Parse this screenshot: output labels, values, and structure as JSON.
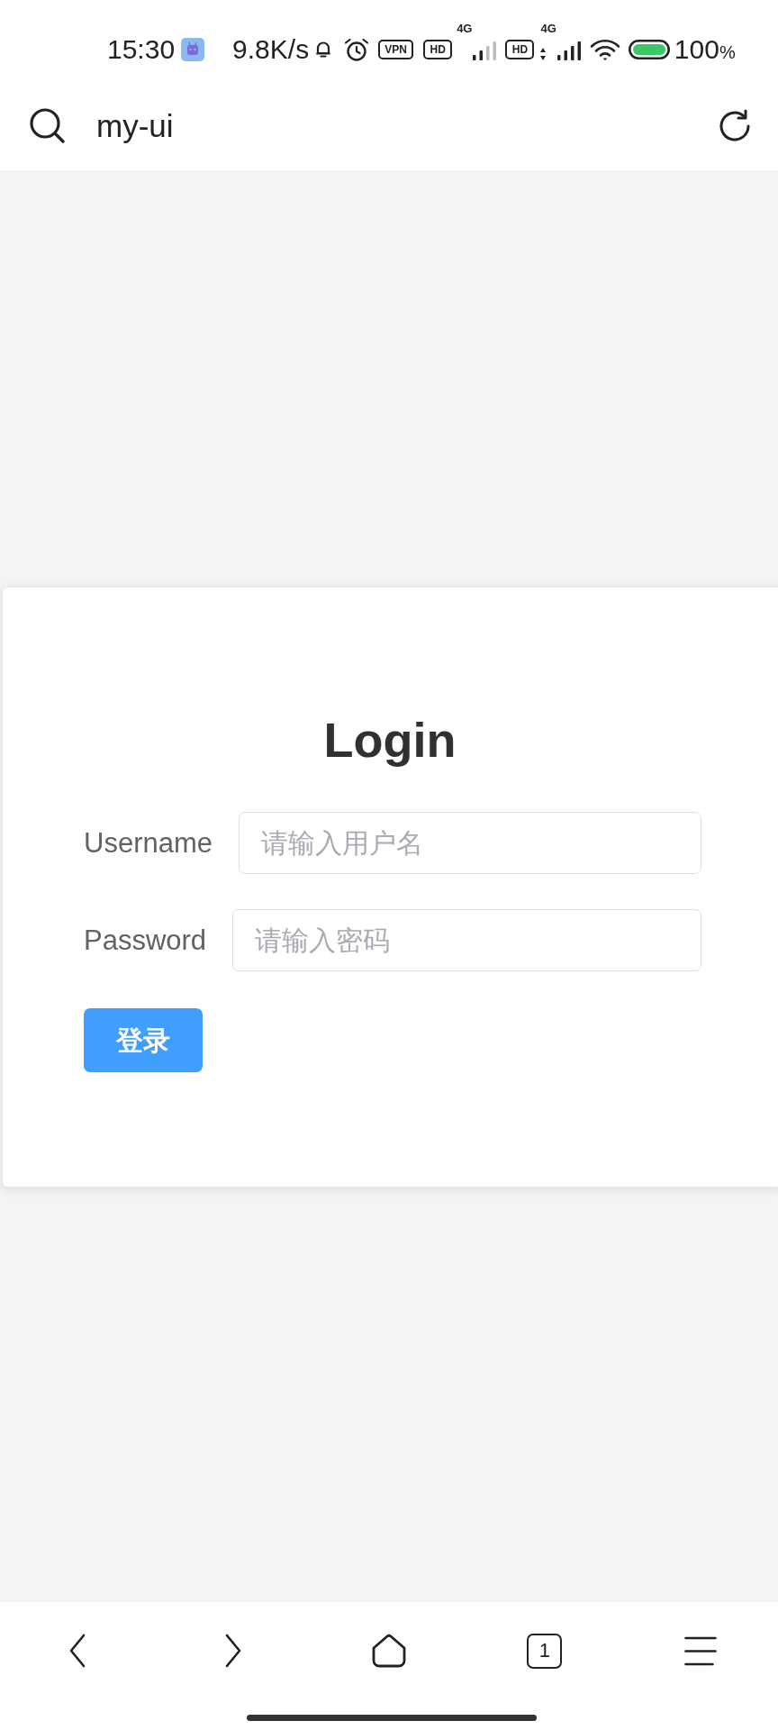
{
  "status_bar": {
    "time": "15:30",
    "net_speed": "9.8K/s",
    "vpn": "VPN",
    "sim_1": {
      "hd": "HD",
      "network": "4G"
    },
    "sim_2": {
      "hd": "HD",
      "network": "4G"
    },
    "battery_percent": "100",
    "battery_unit": "%"
  },
  "address_bar": {
    "url": "my-ui"
  },
  "login_form": {
    "title": "Login",
    "fields": [
      {
        "label": "Username",
        "placeholder": "请输入用户名"
      },
      {
        "label": "Password",
        "placeholder": "请输入密码"
      }
    ],
    "submit": "登录"
  },
  "nav_bar": {
    "tab_count": "1"
  }
}
